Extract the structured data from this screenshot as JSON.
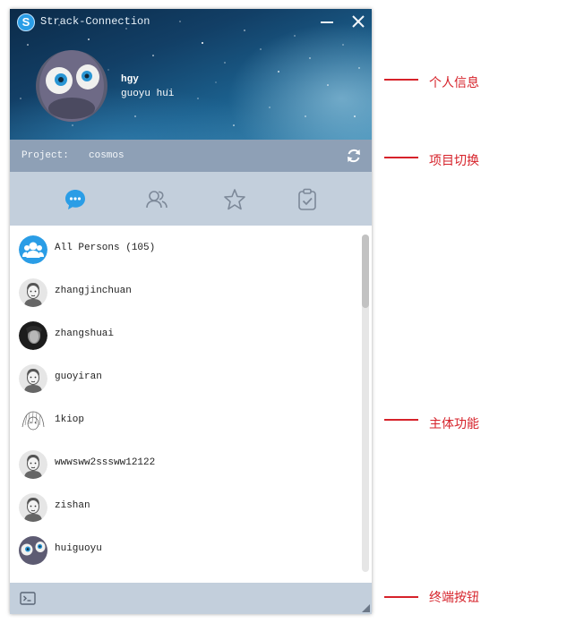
{
  "window": {
    "title": "Strack-Connection",
    "logo_letter": "S"
  },
  "user": {
    "username": "hgy",
    "full_name": "guoyu hui"
  },
  "project": {
    "label": "Project:",
    "name": "cosmos"
  },
  "tabs": [
    {
      "name": "chat",
      "icon": "chat-bubble-icon",
      "active": true
    },
    {
      "name": "contacts",
      "icon": "people-icon",
      "active": false
    },
    {
      "name": "favorites",
      "icon": "star-icon",
      "active": false
    },
    {
      "name": "tasks",
      "icon": "clipboard-check-icon",
      "active": false
    }
  ],
  "list": [
    {
      "label": "All Persons (105)",
      "avatar": "group-icon"
    },
    {
      "label": "zhangjinchuan",
      "avatar": "default-person"
    },
    {
      "label": "zhangshuai",
      "avatar": "dark-photo"
    },
    {
      "label": "guoyiran",
      "avatar": "default-person"
    },
    {
      "label": "1kiop",
      "avatar": "sketch-photo"
    },
    {
      "label": "wwwsww2sssww12122",
      "avatar": "default-person"
    },
    {
      "label": "zishan",
      "avatar": "default-person"
    },
    {
      "label": "huiguoyu",
      "avatar": "eyes-photo"
    }
  ],
  "annotations": [
    {
      "text": "个人信息"
    },
    {
      "text": "项目切换"
    },
    {
      "text": "主体功能"
    },
    {
      "text": "终端按钮"
    }
  ],
  "colors": {
    "accent": "#2a9de6",
    "project_bar": "#8ea0b6",
    "tab_bar": "#c3cfdc",
    "annotation": "#d6222a"
  }
}
